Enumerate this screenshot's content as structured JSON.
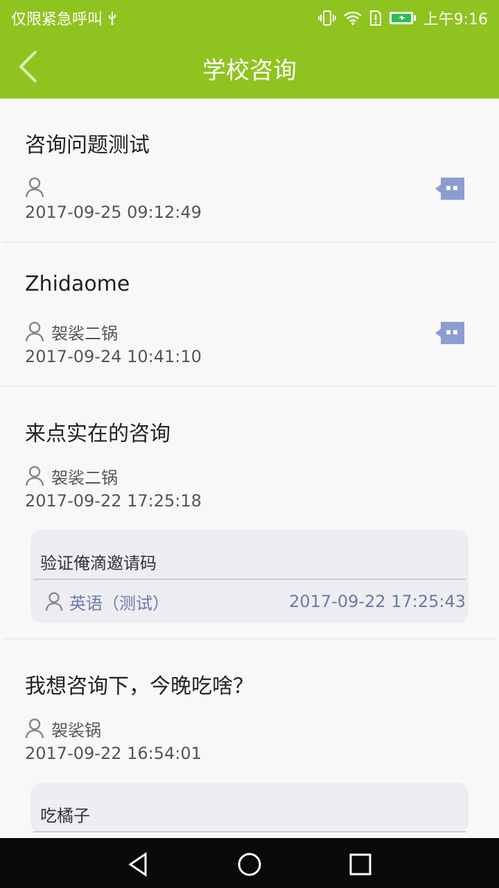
{
  "status": {
    "carrier": "仅限紧急呼叫",
    "time": "上午9:16"
  },
  "header": {
    "title": "学校咨询"
  },
  "items": [
    {
      "title": "咨询问题测试",
      "author": "",
      "time": "2017-09-25 09:12:49"
    },
    {
      "title": "Zhidaome",
      "author": "袈裟二锅",
      "time": "2017-09-24 10:41:10"
    },
    {
      "title": "来点实在的咨询",
      "author": "袈裟二锅",
      "time": "2017-09-22 17:25:18",
      "reply": {
        "text": "验证俺滴邀请码",
        "author": "英语（测试）",
        "time": "2017-09-22 17:25:43"
      }
    },
    {
      "title": "我想咨询下，今晚吃啥？",
      "author": "袈裟锅",
      "time": "2017-09-22 16:54:01",
      "reply": {
        "text": "吃橘子"
      }
    }
  ],
  "colors": {
    "header": "#8fc31f",
    "chat_icon": "#8c9dd1"
  }
}
